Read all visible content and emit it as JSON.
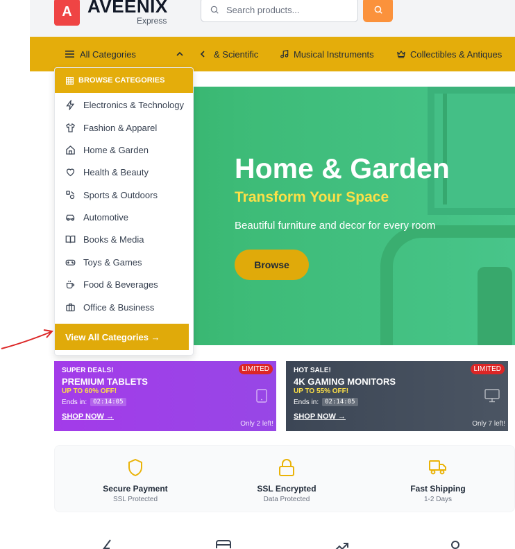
{
  "header": {
    "logo_letter": "A",
    "logo_name": "AVEENIX",
    "logo_sub": "Express",
    "search_placeholder": "Search products..."
  },
  "nav": {
    "all_categories": "All Categories",
    "items": [
      {
        "label": "& Scientific",
        "icon": "none"
      },
      {
        "label": "Musical Instruments",
        "icon": "music-icon"
      },
      {
        "label": "Collectibles & Antiques",
        "icon": "crown-icon"
      }
    ]
  },
  "dropdown": {
    "header": "BROWSE CATEGORIES",
    "items": [
      {
        "label": "Electronics & Technology",
        "icon": "bolt-icon"
      },
      {
        "label": "Fashion & Apparel",
        "icon": "shirt-icon"
      },
      {
        "label": "Home & Garden",
        "icon": "home-icon"
      },
      {
        "label": "Health & Beauty",
        "icon": "heart-icon"
      },
      {
        "label": "Sports & Outdoors",
        "icon": "sports-icon"
      },
      {
        "label": "Automotive",
        "icon": "car-icon"
      },
      {
        "label": "Books & Media",
        "icon": "book-icon"
      },
      {
        "label": "Toys & Games",
        "icon": "gamepad-icon"
      },
      {
        "label": "Food & Beverages",
        "icon": "cup-icon"
      },
      {
        "label": "Office & Business",
        "icon": "briefcase-icon"
      }
    ],
    "footer": "View All Categories →"
  },
  "hero": {
    "title": "Home & Garden",
    "subtitle": "Transform Your Space",
    "description": "Beautiful furniture and decor for every room",
    "button": "Browse"
  },
  "deals": [
    {
      "kicker": "SUPER DEALS!",
      "title": "PREMIUM TABLETS",
      "off": "UP TO 60% OFF!",
      "ends_label": "Ends in:",
      "timer": "02:14:05",
      "shop": "SHOP NOW →",
      "badge": "LIMITED",
      "left": "Only 2 left!",
      "icon": "tablet-icon"
    },
    {
      "kicker": "HOT SALE!",
      "title": "4K GAMING MONITORS",
      "off": "UP TO 55% OFF!",
      "ends_label": "Ends in:",
      "timer": "02:14:05",
      "shop": "SHOP NOW →",
      "badge": "LIMITED",
      "left": "Only 7 left!",
      "icon": "monitor-icon"
    }
  ],
  "features": [
    {
      "title": "Secure Payment",
      "sub": "SSL Protected",
      "icon": "shield-icon"
    },
    {
      "title": "SSL Encrypted",
      "sub": "Data Protected",
      "icon": "lock-icon"
    },
    {
      "title": "Fast Shipping",
      "sub": "1-2 Days",
      "icon": "truck-icon"
    }
  ],
  "colors": {
    "accent": "#e4ad0b",
    "search_button": "#fb923c",
    "logo": "#ef4444",
    "hero_green": "#3dbb77",
    "deal_purple": "#a33be9",
    "deal_gray": "#3c4655",
    "badge_red": "#dc2626"
  }
}
